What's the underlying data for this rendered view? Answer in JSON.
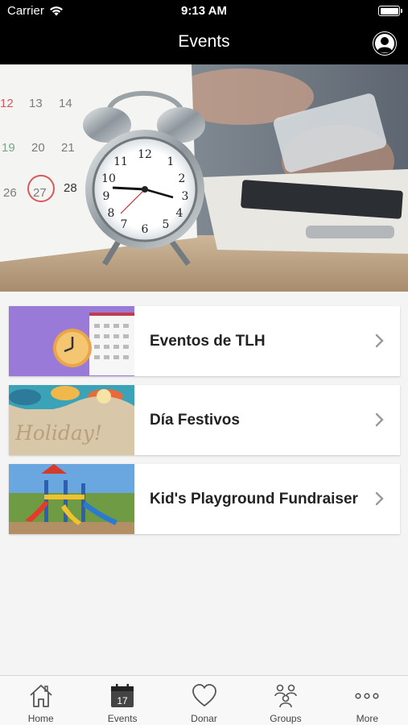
{
  "status": {
    "carrier": "Carrier",
    "time": "9:13 AM"
  },
  "header": {
    "title": "Events"
  },
  "hero_calendar": {
    "row1": [
      "12",
      "13",
      "14"
    ],
    "row2": [
      "19",
      "20",
      "21"
    ],
    "row3": [
      "26",
      "27",
      "28"
    ]
  },
  "events": [
    {
      "label": "Eventos de TLH"
    },
    {
      "label": "Día Festivos"
    },
    {
      "label": "Kid's Playground Fundraiser"
    }
  ],
  "thumb_text": {
    "holiday": "Holiday!"
  },
  "tabs": [
    {
      "label": "Home",
      "icon": "home-icon"
    },
    {
      "label": "Events",
      "icon": "calendar-icon",
      "badge": "17"
    },
    {
      "label": "Donar",
      "icon": "heart-icon"
    },
    {
      "label": "Groups",
      "icon": "groups-icon"
    },
    {
      "label": "More",
      "icon": "more-icon"
    }
  ],
  "colors": {
    "bar": "#000000",
    "background": "#f4f4f4",
    "card": "#ffffff",
    "tab_bar": "#f8f8f8"
  }
}
